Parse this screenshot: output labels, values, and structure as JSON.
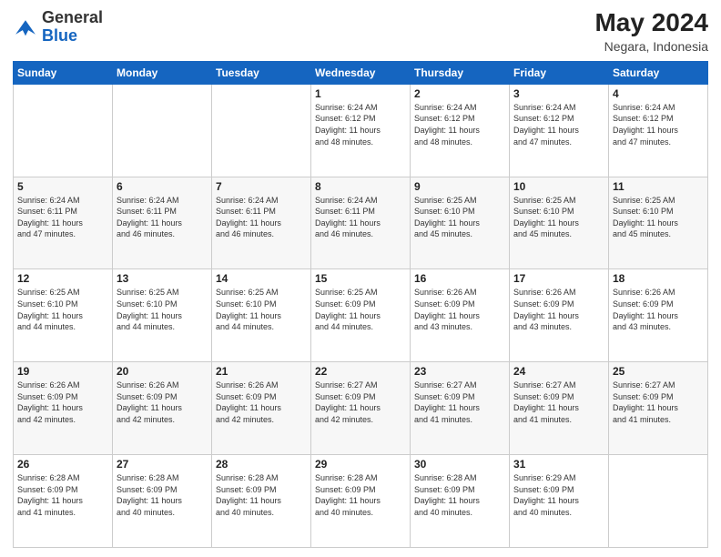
{
  "header": {
    "logo_general": "General",
    "logo_blue": "Blue",
    "month_year": "May 2024",
    "location": "Negara, Indonesia"
  },
  "weekdays": [
    "Sunday",
    "Monday",
    "Tuesday",
    "Wednesday",
    "Thursday",
    "Friday",
    "Saturday"
  ],
  "weeks": [
    [
      {
        "day": "",
        "info": ""
      },
      {
        "day": "",
        "info": ""
      },
      {
        "day": "",
        "info": ""
      },
      {
        "day": "1",
        "info": "Sunrise: 6:24 AM\nSunset: 6:12 PM\nDaylight: 11 hours\nand 48 minutes."
      },
      {
        "day": "2",
        "info": "Sunrise: 6:24 AM\nSunset: 6:12 PM\nDaylight: 11 hours\nand 48 minutes."
      },
      {
        "day": "3",
        "info": "Sunrise: 6:24 AM\nSunset: 6:12 PM\nDaylight: 11 hours\nand 47 minutes."
      },
      {
        "day": "4",
        "info": "Sunrise: 6:24 AM\nSunset: 6:12 PM\nDaylight: 11 hours\nand 47 minutes."
      }
    ],
    [
      {
        "day": "5",
        "info": "Sunrise: 6:24 AM\nSunset: 6:11 PM\nDaylight: 11 hours\nand 47 minutes."
      },
      {
        "day": "6",
        "info": "Sunrise: 6:24 AM\nSunset: 6:11 PM\nDaylight: 11 hours\nand 46 minutes."
      },
      {
        "day": "7",
        "info": "Sunrise: 6:24 AM\nSunset: 6:11 PM\nDaylight: 11 hours\nand 46 minutes."
      },
      {
        "day": "8",
        "info": "Sunrise: 6:24 AM\nSunset: 6:11 PM\nDaylight: 11 hours\nand 46 minutes."
      },
      {
        "day": "9",
        "info": "Sunrise: 6:25 AM\nSunset: 6:10 PM\nDaylight: 11 hours\nand 45 minutes."
      },
      {
        "day": "10",
        "info": "Sunrise: 6:25 AM\nSunset: 6:10 PM\nDaylight: 11 hours\nand 45 minutes."
      },
      {
        "day": "11",
        "info": "Sunrise: 6:25 AM\nSunset: 6:10 PM\nDaylight: 11 hours\nand 45 minutes."
      }
    ],
    [
      {
        "day": "12",
        "info": "Sunrise: 6:25 AM\nSunset: 6:10 PM\nDaylight: 11 hours\nand 44 minutes."
      },
      {
        "day": "13",
        "info": "Sunrise: 6:25 AM\nSunset: 6:10 PM\nDaylight: 11 hours\nand 44 minutes."
      },
      {
        "day": "14",
        "info": "Sunrise: 6:25 AM\nSunset: 6:10 PM\nDaylight: 11 hours\nand 44 minutes."
      },
      {
        "day": "15",
        "info": "Sunrise: 6:25 AM\nSunset: 6:09 PM\nDaylight: 11 hours\nand 44 minutes."
      },
      {
        "day": "16",
        "info": "Sunrise: 6:26 AM\nSunset: 6:09 PM\nDaylight: 11 hours\nand 43 minutes."
      },
      {
        "day": "17",
        "info": "Sunrise: 6:26 AM\nSunset: 6:09 PM\nDaylight: 11 hours\nand 43 minutes."
      },
      {
        "day": "18",
        "info": "Sunrise: 6:26 AM\nSunset: 6:09 PM\nDaylight: 11 hours\nand 43 minutes."
      }
    ],
    [
      {
        "day": "19",
        "info": "Sunrise: 6:26 AM\nSunset: 6:09 PM\nDaylight: 11 hours\nand 42 minutes."
      },
      {
        "day": "20",
        "info": "Sunrise: 6:26 AM\nSunset: 6:09 PM\nDaylight: 11 hours\nand 42 minutes."
      },
      {
        "day": "21",
        "info": "Sunrise: 6:26 AM\nSunset: 6:09 PM\nDaylight: 11 hours\nand 42 minutes."
      },
      {
        "day": "22",
        "info": "Sunrise: 6:27 AM\nSunset: 6:09 PM\nDaylight: 11 hours\nand 42 minutes."
      },
      {
        "day": "23",
        "info": "Sunrise: 6:27 AM\nSunset: 6:09 PM\nDaylight: 11 hours\nand 41 minutes."
      },
      {
        "day": "24",
        "info": "Sunrise: 6:27 AM\nSunset: 6:09 PM\nDaylight: 11 hours\nand 41 minutes."
      },
      {
        "day": "25",
        "info": "Sunrise: 6:27 AM\nSunset: 6:09 PM\nDaylight: 11 hours\nand 41 minutes."
      }
    ],
    [
      {
        "day": "26",
        "info": "Sunrise: 6:28 AM\nSunset: 6:09 PM\nDaylight: 11 hours\nand 41 minutes."
      },
      {
        "day": "27",
        "info": "Sunrise: 6:28 AM\nSunset: 6:09 PM\nDaylight: 11 hours\nand 40 minutes."
      },
      {
        "day": "28",
        "info": "Sunrise: 6:28 AM\nSunset: 6:09 PM\nDaylight: 11 hours\nand 40 minutes."
      },
      {
        "day": "29",
        "info": "Sunrise: 6:28 AM\nSunset: 6:09 PM\nDaylight: 11 hours\nand 40 minutes."
      },
      {
        "day": "30",
        "info": "Sunrise: 6:28 AM\nSunset: 6:09 PM\nDaylight: 11 hours\nand 40 minutes."
      },
      {
        "day": "31",
        "info": "Sunrise: 6:29 AM\nSunset: 6:09 PM\nDaylight: 11 hours\nand 40 minutes."
      },
      {
        "day": "",
        "info": ""
      }
    ]
  ]
}
